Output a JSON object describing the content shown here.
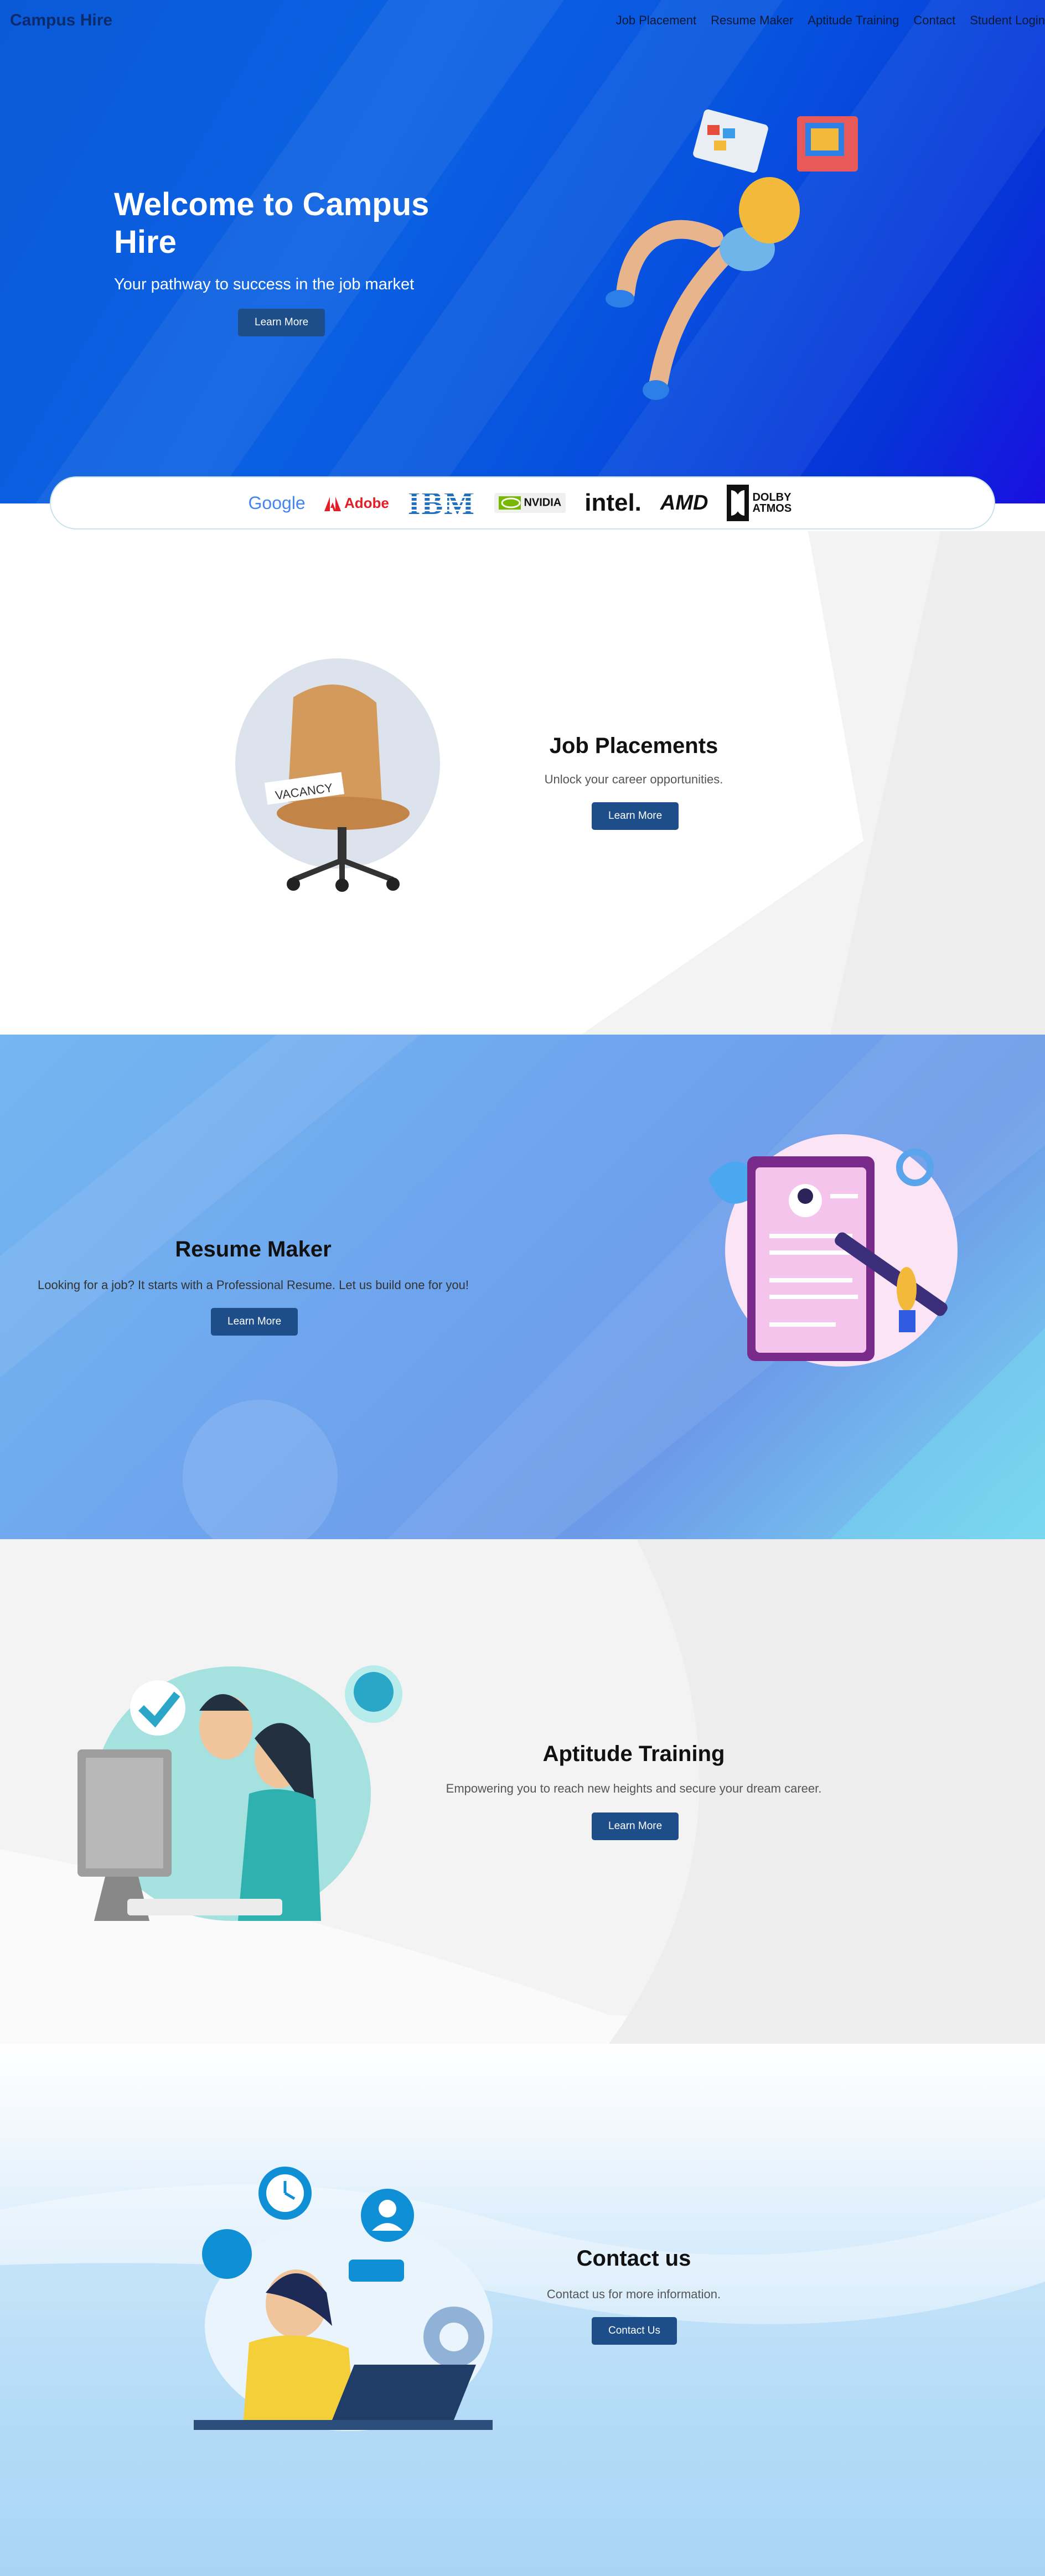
{
  "nav": {
    "brand": "Campus Hire",
    "links": [
      "Job Placement",
      "Resume Maker",
      "Aptitude Training",
      "Contact",
      "Student Login"
    ]
  },
  "hero": {
    "title": "Welcome to Campus Hire",
    "subtitle": "Your pathway to success in the job market",
    "button": "Learn More"
  },
  "partners": [
    "Google",
    "Adobe",
    "IBM",
    "NVIDIA",
    "intel.",
    "AMD",
    "DOLBY ATMOS"
  ],
  "sections": {
    "jobs": {
      "title": "Job Placements",
      "subtitle": "Unlock your career opportunities.",
      "button": "Learn More",
      "illustration_text": "VACANCY"
    },
    "resume": {
      "title": "Resume Maker",
      "subtitle": "Looking for a job? It starts with a Professional Resume. Let us build one for you!",
      "button": "Learn More"
    },
    "aptitude": {
      "title": "Aptitude Training",
      "subtitle": "Empowering you to reach new heights and secure your dream career.",
      "button": "Learn More"
    },
    "contact": {
      "title": "Contact us",
      "subtitle": "Contact us for more information.",
      "button": "Contact Us"
    }
  },
  "colors": {
    "hero_blue": "#0b61e3",
    "button": "#1d4e89",
    "resume_bg": "#6fa6ee"
  }
}
